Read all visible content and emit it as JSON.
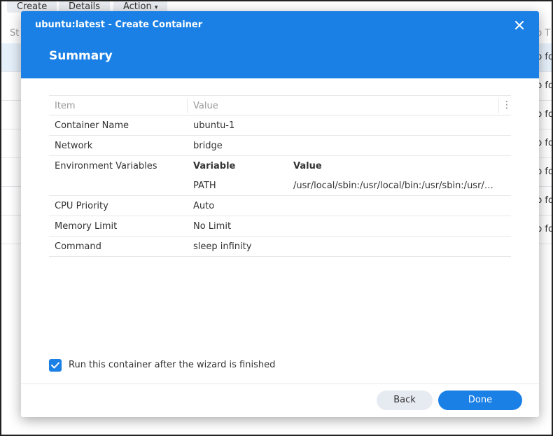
{
  "background": {
    "toolbar": {
      "create_label": "Create",
      "details_label": "Details",
      "action_label": "Action"
    },
    "column_left": "St",
    "column_right": "p T",
    "row_text": "p fo"
  },
  "dialog": {
    "title": "ubuntu:latest - Create Container",
    "step_title": "Summary",
    "close_icon": "close-icon",
    "table": {
      "headers": {
        "item": "Item",
        "value": "Value"
      },
      "rows": [
        {
          "item": "Container Name",
          "value": "ubuntu-1"
        },
        {
          "item": "Network",
          "value": "bridge"
        }
      ],
      "env": {
        "item": "Environment Variables",
        "variable_header": "Variable",
        "value_header": "Value",
        "variable": "PATH",
        "value": "/usr/local/sbin:/usr/local/bin:/usr/sbin:/usr/bin:/sbin:/bin"
      },
      "rows_after": [
        {
          "item": "CPU Priority",
          "value": "Auto"
        },
        {
          "item": "Memory Limit",
          "value": "No Limit"
        },
        {
          "item": "Command",
          "value": "sleep infinity"
        }
      ]
    },
    "checkbox_label": "Run this container after the wizard is finished",
    "checkbox_checked": true,
    "back_label": "Back",
    "done_label": "Done"
  },
  "colors": {
    "accent": "#1a80e5",
    "secondary_button": "#e6ebf2"
  }
}
